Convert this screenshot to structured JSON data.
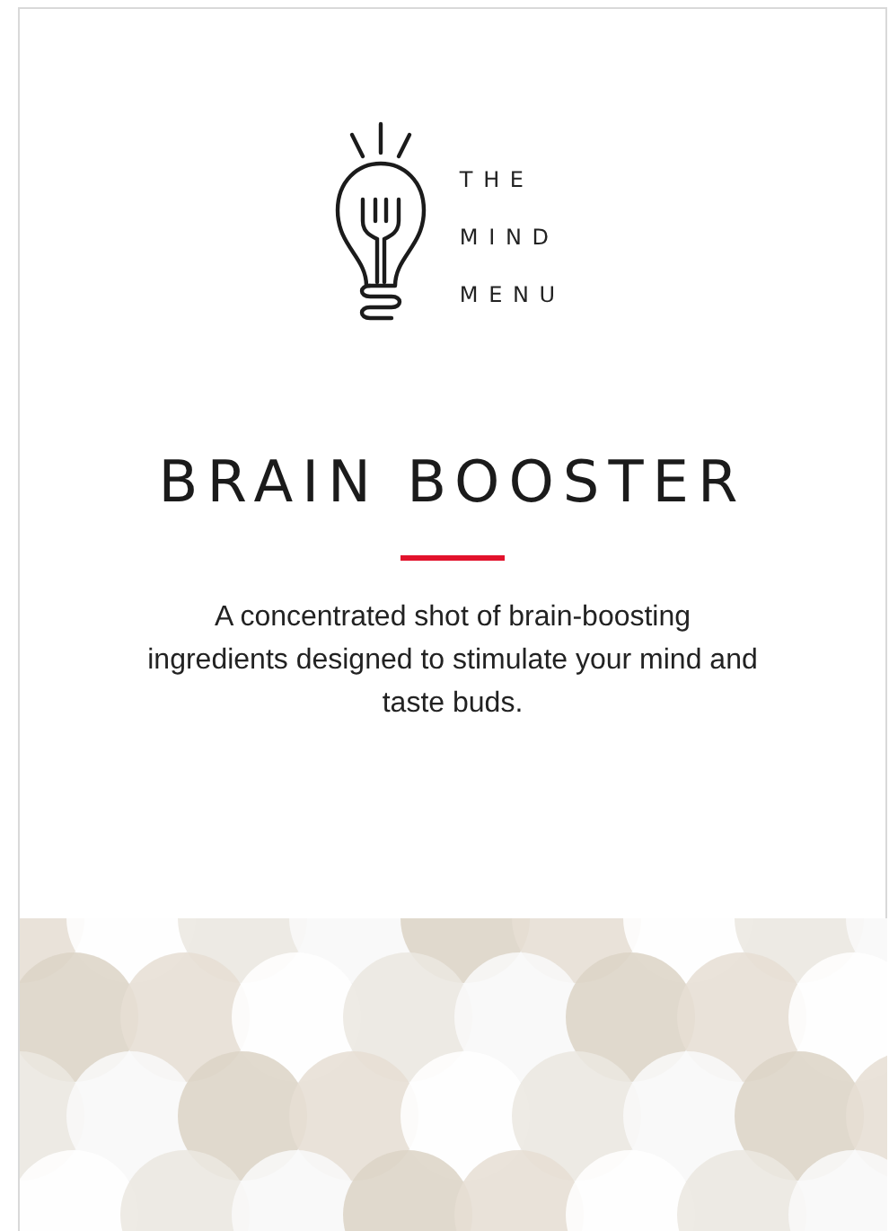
{
  "logo": {
    "lines": [
      "T H E",
      "M I N D",
      "M E N U"
    ]
  },
  "title": "BRAIN BOOSTER",
  "description": "A concentrated shot of brain-boosting ingredients designed to stimulate your mind and taste buds."
}
